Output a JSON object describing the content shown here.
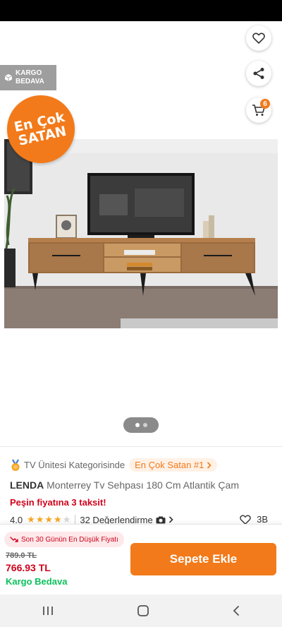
{
  "header": {
    "back_icon": "arrow-left-icon",
    "favorite_icon": "heart-outline-icon",
    "share_icon": "share-icon",
    "cart_icon": "cart-icon",
    "cart_count": "6"
  },
  "badges": {
    "kargo_line1": "KARGO",
    "kargo_line2": "BEDAVA",
    "bestseller_line1": "En Çok",
    "bestseller_line2": "SATAN"
  },
  "gallery": {
    "image_count": 2,
    "active_index": 0
  },
  "product": {
    "category_text": "TV Ünitesi Kategorisinde",
    "category_rank": "En Çok Satan #1",
    "brand": "LENDA",
    "name": "Monterrey Tv Sehpası 180 Cm Atlantik Çam",
    "installment": "Peşin fiyatına 3 taksit!",
    "rating": "4.0",
    "rating_value": 4,
    "review_text": "32 Değerlendirme",
    "favorites": "3B"
  },
  "purchase": {
    "low_price_label": "Son 30 Günün En Düşük Fiyatı",
    "old_price": "789.0 TL",
    "new_price": "766.93 TL",
    "shipping": "Kargo Bedava",
    "add_to_cart": "Sepete Ekle"
  },
  "colors": {
    "brand_orange": "#f27a1a",
    "price_red": "#d0021b",
    "shipping_green": "#0bc15c"
  }
}
